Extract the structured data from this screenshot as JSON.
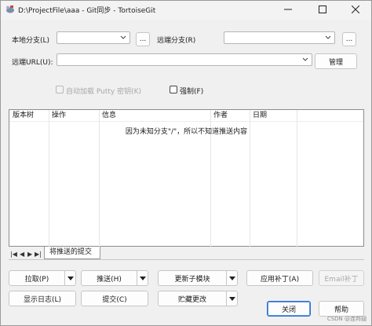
{
  "window": {
    "title": "D:\\ProjectFile\\aaa - Git同步 - TortoiseGit",
    "minimize": "—",
    "maximize": "☐",
    "close": "✕"
  },
  "form": {
    "local_branch_label": "本地分支(L)",
    "local_branch_value": "",
    "local_browse": "...",
    "remote_branch_label": "远端分支(R)",
    "remote_branch_value": "",
    "remote_browse": "...",
    "remote_url_label": "远端URL(U):",
    "remote_url_value": "",
    "manage_label": "管理",
    "autoload_putty_label": "自动加载 Putty 密钥(K)",
    "autoload_putty_checked": false,
    "force_label": "强制(F)",
    "force_checked": false
  },
  "table": {
    "columns": [
      "版本树",
      "操作",
      "信息",
      "作者",
      "日期"
    ],
    "empty_message": "因为未知分支\"/\"，所以不知道推送内容"
  },
  "tabs": {
    "nav": [
      "|◀",
      "◀",
      "▶",
      "▶|"
    ],
    "active": "将推送的提交"
  },
  "buttons": {
    "pull": "拉取(P)",
    "push": "推送(H)",
    "update_submodules": "更新子模块",
    "apply_patch": "应用补丁(A)",
    "email_patch": "Email补丁",
    "show_log": "显示日志(L)",
    "commit": "提交(C)",
    "stash": "贮藏更改",
    "close": "关闭",
    "help": "帮助"
  },
  "watermark": "CSDN @连邦翅"
}
